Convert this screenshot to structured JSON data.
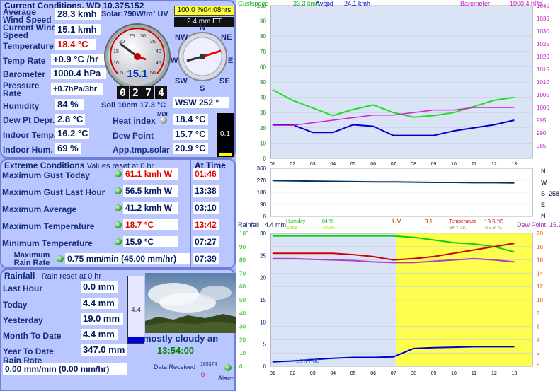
{
  "current": {
    "title": "Current Conditions, WD 10.37S152",
    "avg_wind_label": "Average Wind Speed",
    "avg_wind": "28.3 kmh",
    "cur_wind_label": "Current Wind Speed",
    "cur_wind": "15.1 kmh",
    "temp_label": "Temperature",
    "temp": "18.4 °C",
    "temp_rate_label": "Temp Rate",
    "temp_rate": "+0.9 °C /hr",
    "baro_label": "Barometer",
    "baro": "1000.4 hPa",
    "press_rate_label": "Pressure Rate",
    "press_rate": "+0.7hPa/3hr",
    "hum_label": "Humidity",
    "hum": "84 %",
    "dew_depr_label": "Dew Pt Depr.",
    "dew_depr": "2.8 °C",
    "indoor_temp_label": "Indoor Temp.",
    "indoor_temp": "16.2 °C",
    "indoor_hum_label": "Indoor Hum.",
    "indoor_hum": "69 %",
    "solar": "Solar:790W/m² UV",
    "uv_box": "100.0 %04:08hrs",
    "et_box": "2.4 mm ET",
    "gust_dial": "15.1",
    "odometer": [
      "0",
      "2",
      "7",
      "4"
    ],
    "soil": "Soil 10cm 17.3 °C",
    "mdi": "MDI",
    "heat_label": "Heat index",
    "heat": "18.4 °C",
    "dew_label": "Dew Point",
    "dew": "15.7 °C",
    "app_label": "App.tmp.solar",
    "app": "20.9 °C",
    "rain_rate_box": "0.1",
    "compass_dir": "WSW  252 °",
    "compass_n": "N",
    "compass_ne": "NE",
    "compass_e": "E",
    "compass_se": "SE",
    "compass_s": "S",
    "compass_sw": "SW",
    "compass_w": "W",
    "compass_nw": "NW",
    "dial_nums": [
      "5",
      "10",
      "15",
      "20",
      "25",
      "30",
      "35",
      "40",
      "45",
      "50"
    ]
  },
  "extreme": {
    "title": "Extreme Conditions",
    "subtitle": "Values reset at 0 hr",
    "at_time": "At Time",
    "rows": [
      {
        "label": "Maximum Gust Today",
        "value": "61.1 kmh  W",
        "time": "01:46",
        "red": true
      },
      {
        "label": "Maximum Gust Last Hour",
        "value": "56.5 kmh  W",
        "time": "13:38",
        "red": false
      },
      {
        "label": "Maximum Average",
        "value": "41.2 kmh  W",
        "time": "03:10",
        "red": false
      },
      {
        "label": "Maximum Temperature",
        "value": "18.7 °C",
        "time": "13:42",
        "red": true
      },
      {
        "label": "Minimum Temperature",
        "value": "15.9 °C",
        "time": "07:27",
        "red": false
      },
      {
        "label": "Maximum Rain Rate",
        "value": "0.75 mm/min (45.00 mm/hr)",
        "time": "07:39",
        "red": false
      }
    ]
  },
  "rainfall": {
    "title": "Rainfall",
    "subtitle": "Rain reset at 0 hr",
    "last_hour_label": "Last Hour",
    "last_hour": "0.0 mm",
    "today_label": "Today",
    "today": "4.4 mm",
    "yesterday_label": "Yesterday",
    "yesterday": "19.0 mm",
    "month_label": "Month To Date",
    "month": "4.4 mm",
    "year_label": "Year To Date",
    "year": "347.0 mm",
    "rate_label": "Rain Rate",
    "rate": "0.00 mm/min (0.00 mm/hr)",
    "gauge_value": "4.4",
    "gauge_fill_fraction": 0.08,
    "sky": "mostly cloudy an",
    "time": "13:54:00",
    "data_received_label": "Data Received",
    "data_received_count": "185374",
    "data_received_zero": "0",
    "alarm": "Alarm"
  },
  "graph_labels": {
    "gustspeed": "Gustspeed",
    "gust_val": "33.3 kmh",
    "avspd": "Avspd",
    "avspd_val": "24.1 kmh",
    "barometer": "Barometer",
    "baro_val": "1000.4 hPa",
    "dir_letters": [
      "N",
      "W",
      "S",
      "258",
      "E",
      "N"
    ],
    "rainfall": "Rainfall",
    "rainfall_val": "4.4 mm",
    "humidity": "Humidity",
    "humidity_val": "84 %",
    "solar": "Solar",
    "solar_val": "100%",
    "uv": "UV",
    "uv_val": "3.1",
    "temperature": "Temperature",
    "temp_val": "18.5 °C",
    "sky": "SKY 1K",
    "sky_val": "-63.8 °C",
    "dewpoint": "Dew Point",
    "dew_val": "15.7",
    "lowtide": "LowTide"
  },
  "chart_data": [
    {
      "type": "line",
      "x": [
        "01",
        "02",
        "03",
        "04",
        "05",
        "06",
        "07",
        "08",
        "09",
        "10",
        "11",
        "12",
        "13"
      ],
      "ylim_left": [
        0,
        100
      ],
      "ylim_right": [
        980,
        1040
      ],
      "y_ticks_left": [
        "0",
        "10",
        "20",
        "30",
        "40",
        "50",
        "60",
        "70",
        "80",
        "90",
        "100"
      ],
      "y_ticks_right": [
        "985",
        "990",
        "995",
        "1000",
        "1005",
        "1010",
        "1015",
        "1020",
        "1025",
        "1030",
        "1035",
        "1040"
      ],
      "series": [
        {
          "name": "Gustspeed",
          "color": "#1ee01e",
          "values": [
            45,
            38,
            33,
            28,
            32,
            35,
            30,
            27,
            28,
            30,
            34,
            38,
            40
          ]
        },
        {
          "name": "Avspd",
          "color": "#0000cc",
          "values": [
            22,
            22,
            17,
            17,
            22,
            21,
            15,
            15,
            15,
            18,
            20,
            22,
            25
          ]
        },
        {
          "name": "Barometer",
          "color": "#d020d0",
          "values": [
            993,
            993,
            994,
            995,
            996,
            997,
            997,
            998,
            999,
            999,
            1000,
            1000,
            1000
          ]
        }
      ]
    },
    {
      "type": "line",
      "x": [
        "01",
        "02",
        "03",
        "04",
        "05",
        "06",
        "07",
        "08",
        "09",
        "10",
        "11",
        "12",
        "13"
      ],
      "ylim": [
        0,
        360
      ],
      "y_ticks": [
        "0",
        "90",
        "180",
        "270",
        "360"
      ],
      "series": [
        {
          "name": "",
          "color": "#003366",
          "values": [
            268,
            266,
            264,
            262,
            260,
            258,
            258,
            256,
            254,
            254,
            252,
            252,
            250
          ]
        }
      ]
    },
    {
      "type": "line",
      "x": [
        "01",
        "02",
        "03",
        "04",
        "05",
        "06",
        "07",
        "08",
        "09",
        "10",
        "11",
        "12",
        "13"
      ],
      "ylim_left": [
        0,
        100
      ],
      "ylim_rain": [
        0,
        30
      ],
      "ylim_right": [
        0,
        20
      ],
      "y_ticks_left": [
        "0",
        "10",
        "20",
        "30",
        "40",
        "50",
        "60",
        "70",
        "80",
        "90",
        "100"
      ],
      "y_ticks_rain": [
        "0",
        "5",
        "10",
        "15",
        "20",
        "25",
        "30"
      ],
      "y_ticks_right": [
        "0",
        "2",
        "4",
        "6",
        "8",
        "10",
        "12",
        "14",
        "16",
        "18",
        "20"
      ],
      "series": [
        {
          "name": "Humidity",
          "color": "#10d010",
          "values": [
            98,
            98,
            98,
            98,
            98,
            98,
            98,
            97,
            95,
            93,
            92,
            90,
            86
          ]
        },
        {
          "name": "Rainfall",
          "color": "#0000cc",
          "values": [
            1.0,
            1.2,
            1.5,
            1.8,
            2.0,
            2.0,
            2.1,
            4.0,
            4.2,
            4.3,
            4.4,
            4.4,
            4.4
          ]
        },
        {
          "name": "Temperature",
          "color": "#cc0000",
          "values": [
            17,
            17,
            17,
            17,
            16.8,
            16.5,
            16.0,
            16.2,
            16.5,
            17.0,
            17.5,
            18.0,
            18.5
          ]
        },
        {
          "name": "Dew Point",
          "color": "#b040c0",
          "values": [
            16.2,
            16.2,
            16.1,
            16.0,
            15.9,
            15.7,
            15.6,
            15.6,
            15.8,
            16.0,
            16.2,
            16.0,
            15.7
          ]
        }
      ]
    }
  ]
}
